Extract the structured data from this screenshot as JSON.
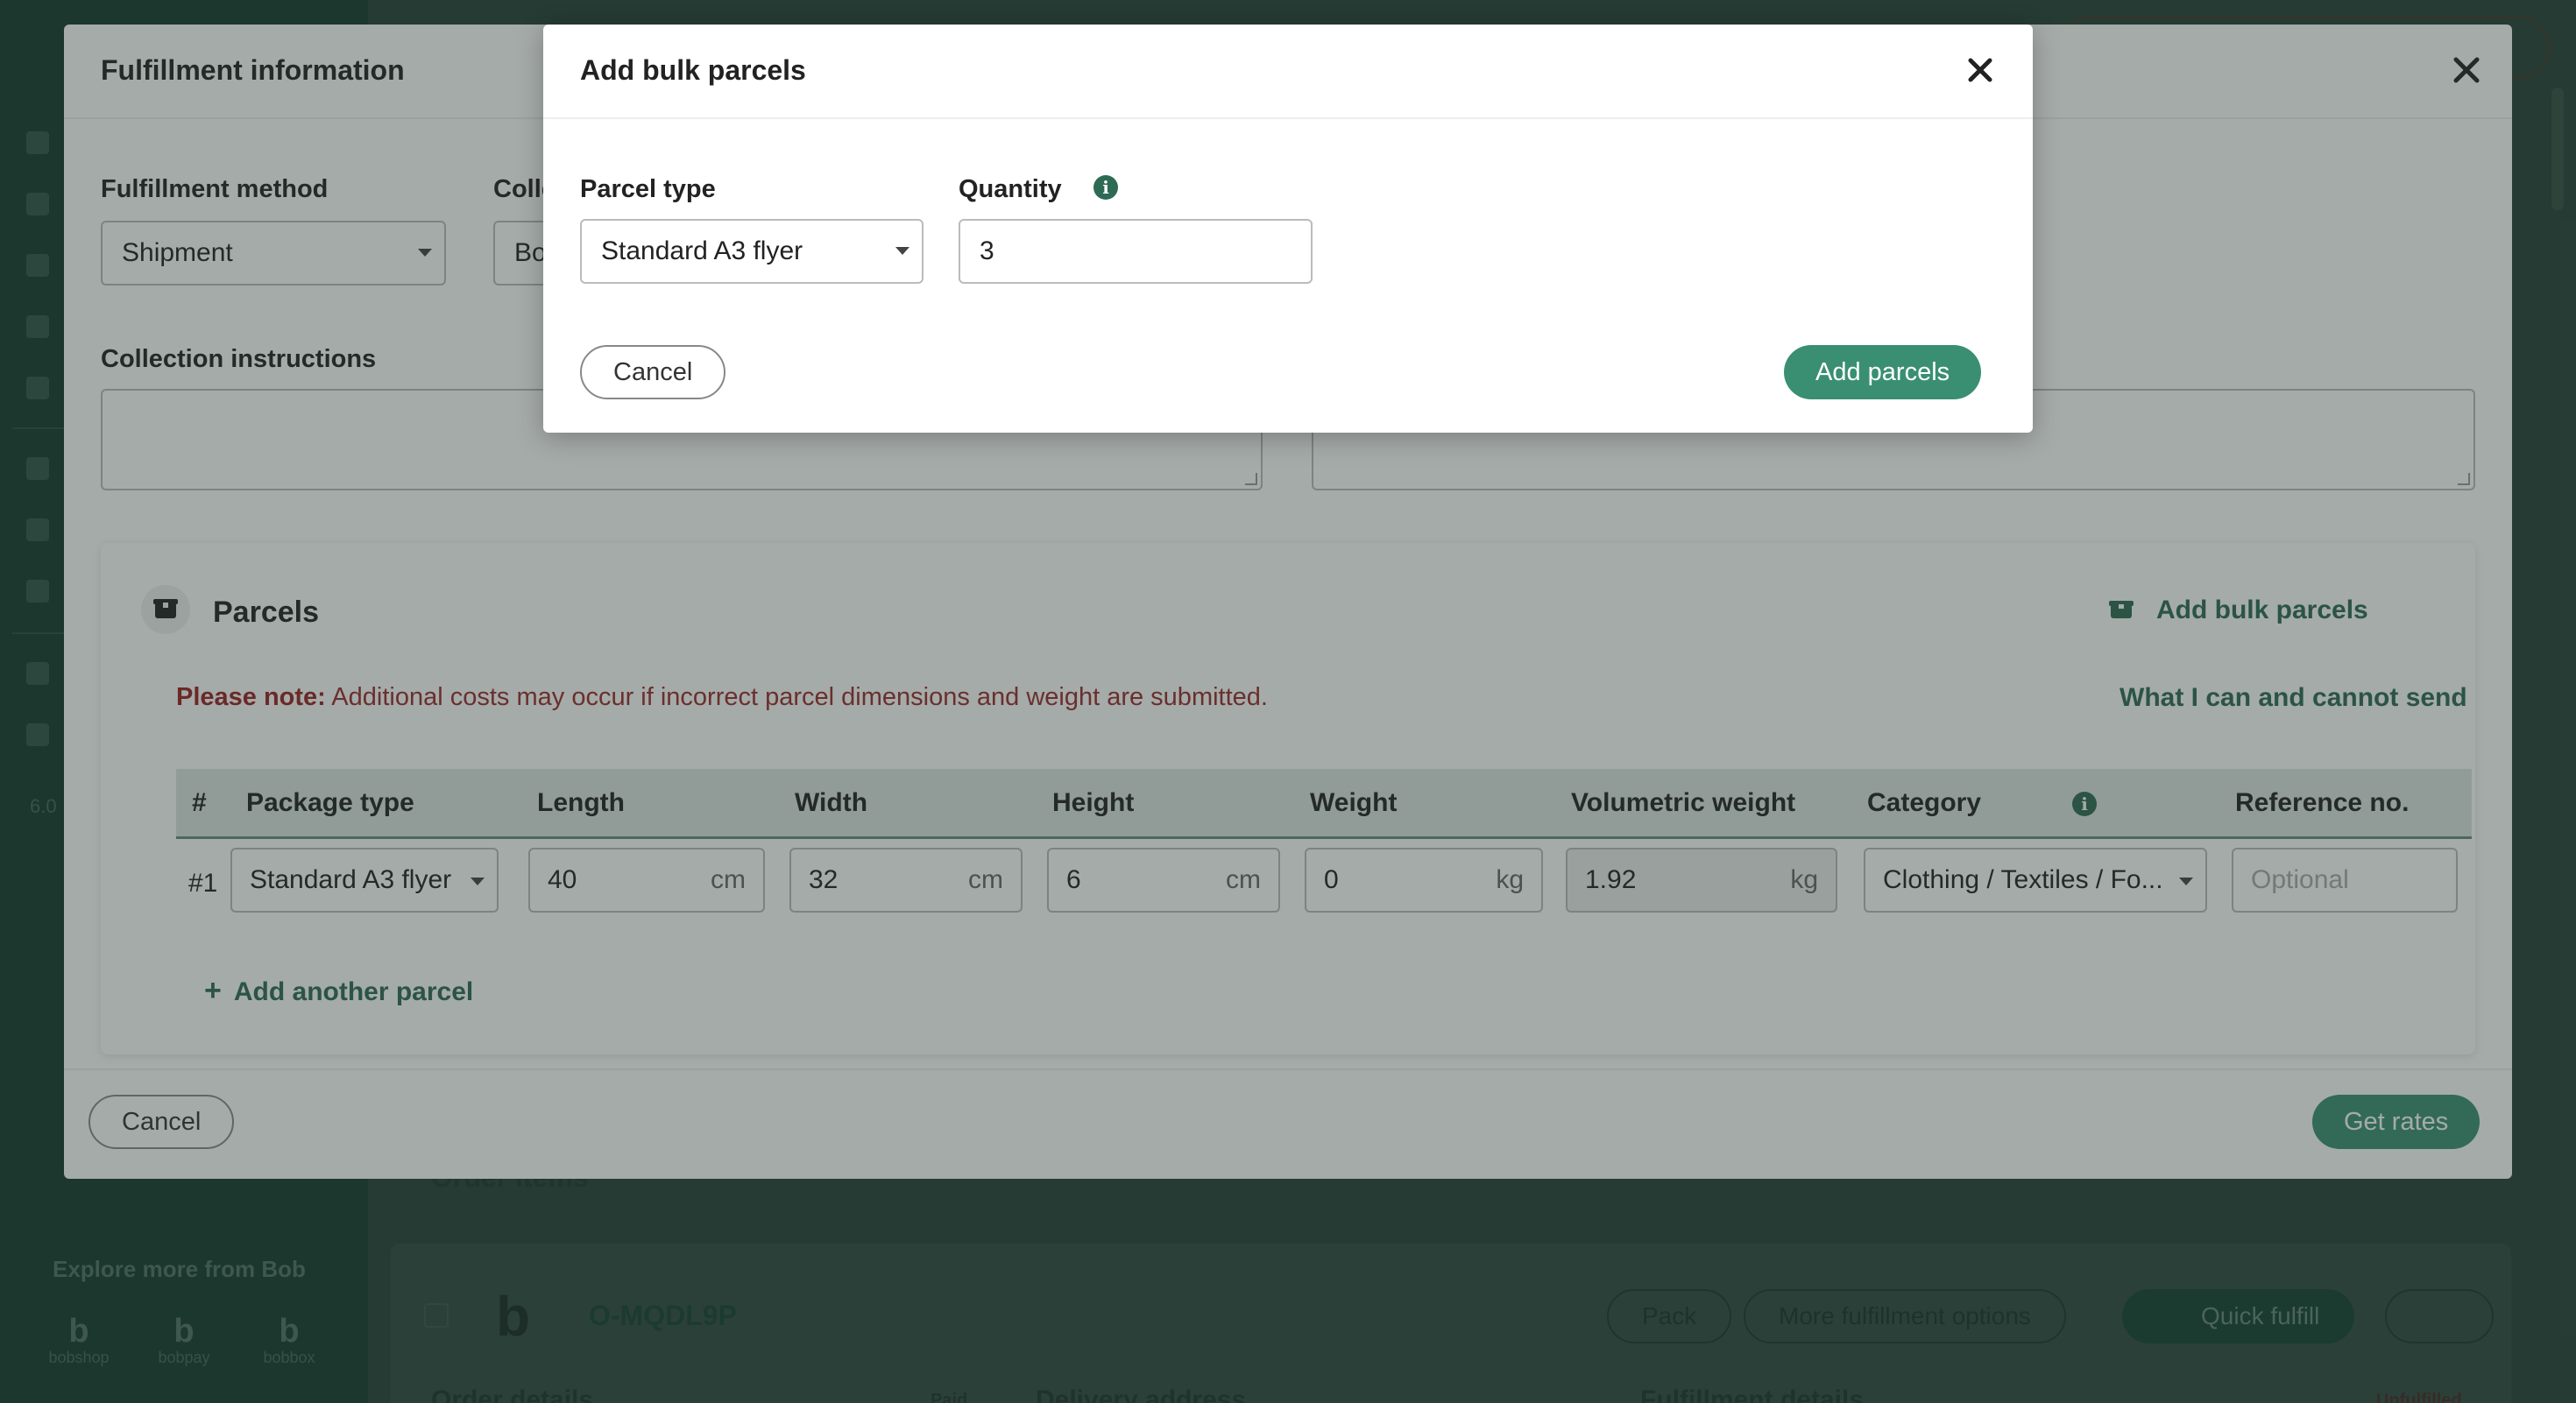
{
  "background": {
    "sidebar": {
      "version": "6.0",
      "explore_label": "Explore more from Bob",
      "brands": [
        "bobshop",
        "bobpay",
        "bobbox"
      ]
    },
    "order_items_label": "Order items",
    "order": {
      "id": "O-MQDL9P",
      "pack_label": "Pack",
      "more_options_label": "More fulfillment options",
      "quick_fulfill_label": "Quick fulfill",
      "order_details_label": "Order details",
      "paid_badge": "Paid",
      "delivery_address_label": "Delivery address",
      "fulfillment_details_label": "Fulfillment details",
      "unfulfilled_badge": "Unfulfilled"
    }
  },
  "fulfillment_modal": {
    "title": "Fulfillment information",
    "method_label": "Fulfillment method",
    "method_value": "Shipment",
    "collection_label": "Colle",
    "collection_value": "Bo",
    "collection_instructions_label": "Collection instructions",
    "parcels": {
      "title": "Parcels",
      "add_bulk_label": "Add bulk parcels",
      "note_prefix": "Please note:",
      "note_text": " Additional costs may occur if incorrect parcel dimensions and weight are submitted.",
      "cannot_send_label": "What I can and cannot send",
      "columns": [
        "#",
        "Package type",
        "Length",
        "Width",
        "Height",
        "Weight",
        "Volumetric weight",
        "Category",
        "Reference no."
      ],
      "rows": [
        {
          "index": "#1",
          "package_type": "Standard A3 flyer",
          "length": "40",
          "width": "32",
          "height": "6",
          "weight": "0",
          "volumetric_weight": "1.92",
          "category": "Clothing / Textiles / Fo...",
          "reference_placeholder": "Optional"
        }
      ],
      "units": {
        "length": "cm",
        "weight": "kg"
      },
      "add_another_label": "Add another parcel"
    },
    "cancel_label": "Cancel",
    "get_rates_label": "Get rates"
  },
  "bulk_modal": {
    "title": "Add bulk parcels",
    "parcel_type_label": "Parcel type",
    "parcel_type_value": "Standard A3 flyer",
    "quantity_label": "Quantity",
    "quantity_value": "3",
    "cancel_label": "Cancel",
    "add_label": "Add parcels"
  },
  "colors": {
    "brand_green": "#3a8f73",
    "link_green": "#2e6a54",
    "warning_red": "#9a2a2a",
    "sidebar": "#0f3f31"
  }
}
